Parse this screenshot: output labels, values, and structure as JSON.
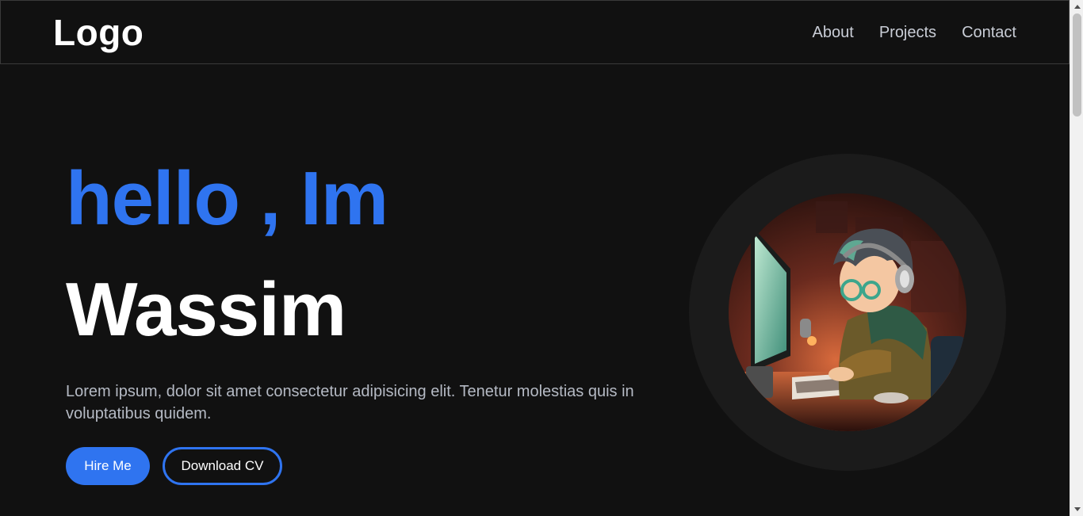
{
  "header": {
    "logo": "Logo",
    "nav": [
      {
        "label": "About"
      },
      {
        "label": "Projects"
      },
      {
        "label": "Contact"
      }
    ]
  },
  "hero": {
    "greeting": "hello , Im",
    "name": "Wassim",
    "bio": "Lorem ipsum, dolor sit amet consectetur adipisicing elit. Tenetur molestias quis in voluptatibus quidem.",
    "buttons": {
      "hire": "Hire Me",
      "download": "Download CV"
    }
  },
  "avatar": {
    "icon": "avatar-illustration"
  },
  "colors": {
    "background": "#111111",
    "accent": "#2f74f0",
    "text": "#ffffff",
    "muted": "#b5bac4"
  },
  "scrollbar": {
    "position": 0
  }
}
